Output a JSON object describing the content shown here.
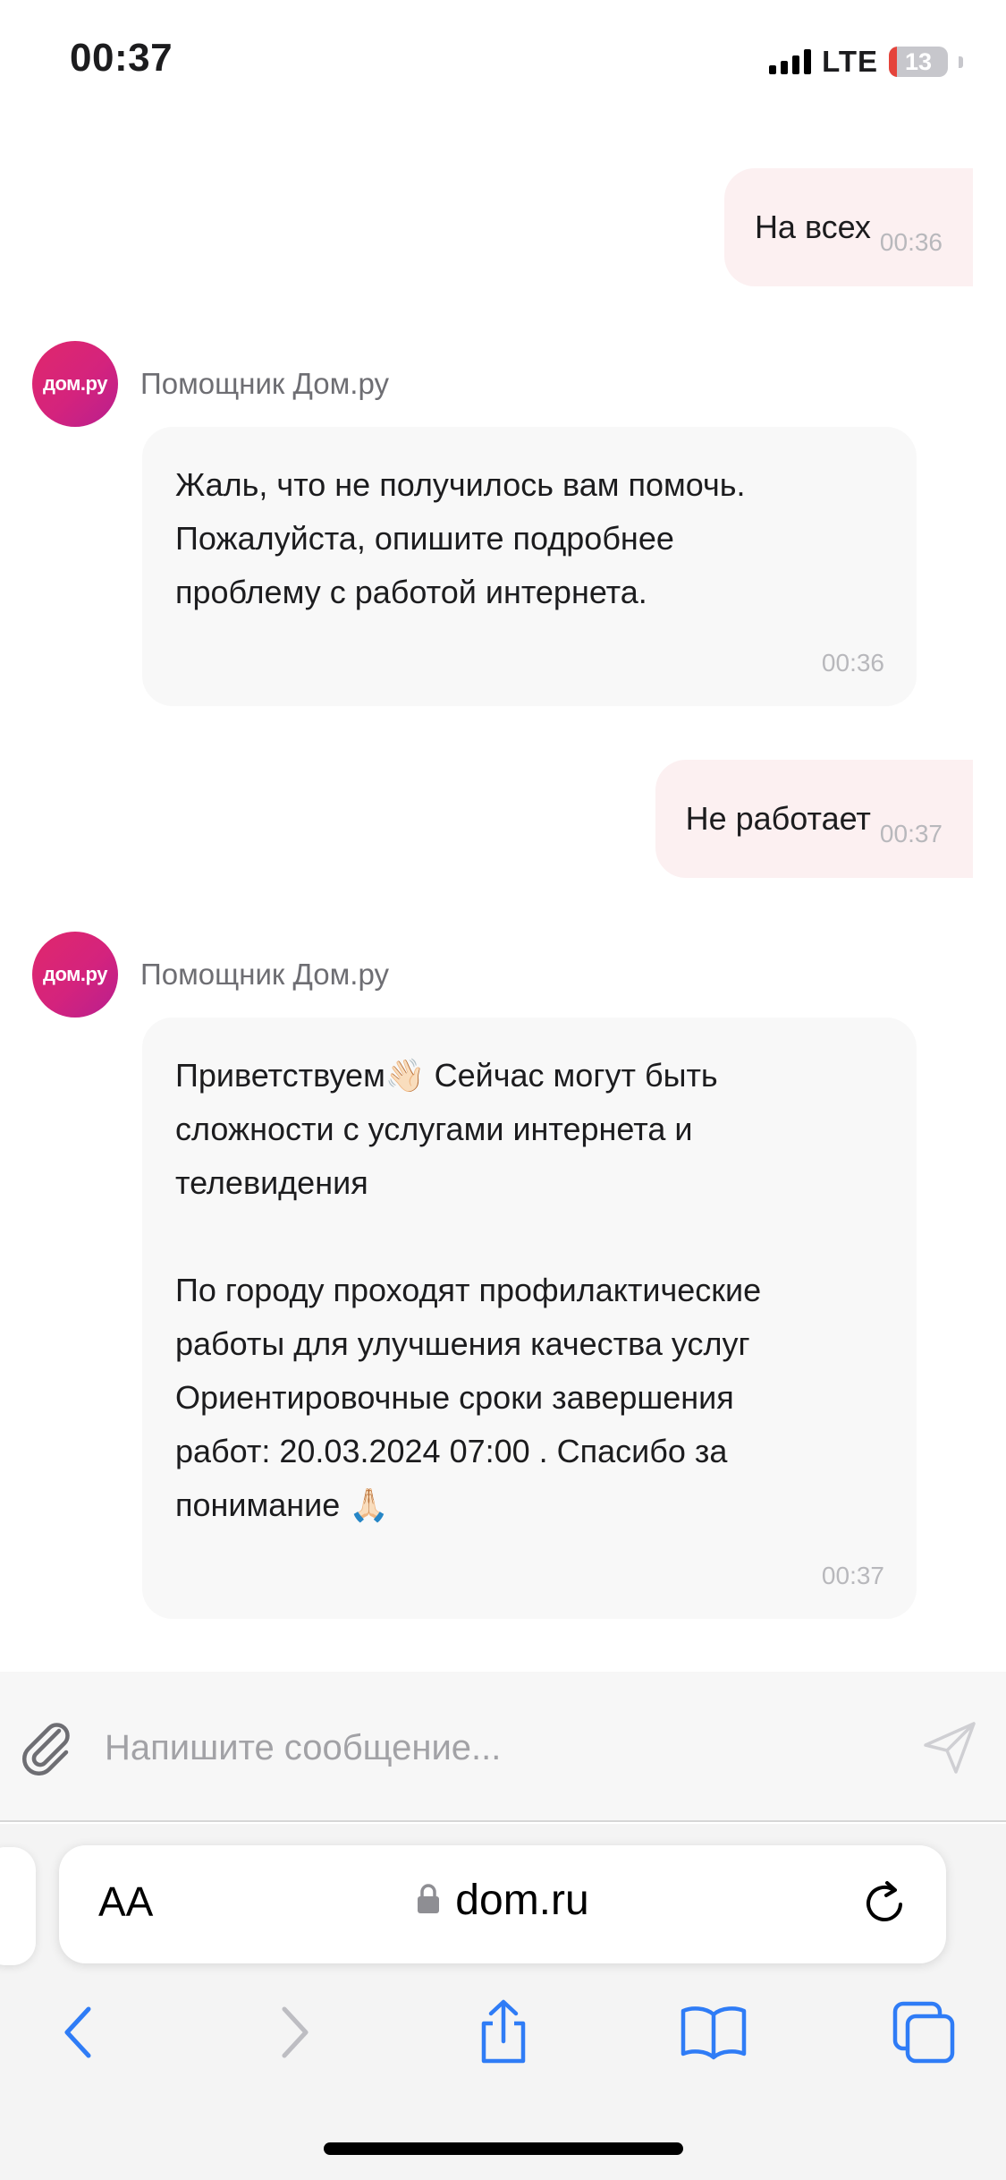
{
  "status_bar": {
    "time": "00:37",
    "network": "LTE",
    "battery_level": "13",
    "battery_color": "#e5443b"
  },
  "chat": {
    "bot_name": "Помощник Дом.ру",
    "bot_avatar_text": "дом.ру",
    "messages": [
      {
        "from": "user",
        "text": "На всех",
        "time": "00:36"
      },
      {
        "from": "bot",
        "text": "Жаль, что не получилось вам помочь. Пожалуйста, опишите подробнее проблему с работой интернета.",
        "time": "00:36"
      },
      {
        "from": "user",
        "text": "Не работает",
        "time": "00:37"
      },
      {
        "from": "bot",
        "text": "Приветствуем👋🏻 Сейчас могут быть сложности с услугами интернета и телевидения\n\nПо городу проходят профилактические работы для улучшения качества услуг\nОриентировочные сроки завершения работ: 20.03.2024 07:00 . Спасибо за понимание 🙏🏻",
        "time": "00:37"
      }
    ]
  },
  "composer": {
    "placeholder": "Напишите сообщение..."
  },
  "browser": {
    "aa_label": "AA",
    "url": "dom.ru"
  },
  "colors": {
    "brand": "#d4237d",
    "accent_blue": "#2f7cf6",
    "user_bubble": "#fcf0f1",
    "bot_bubble": "#f8f8f8"
  }
}
